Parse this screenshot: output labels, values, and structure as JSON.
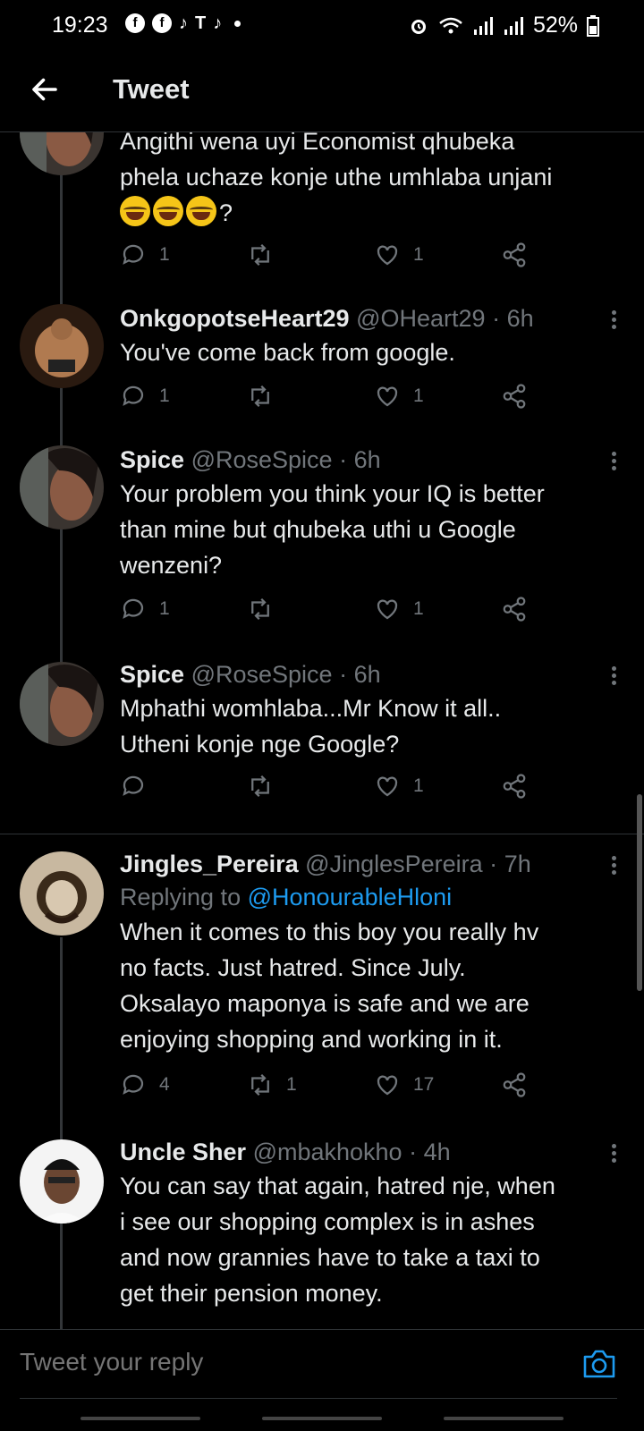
{
  "status_bar": {
    "time": "19:23",
    "battery": "52%",
    "left_icons": [
      "facebook-icon",
      "facebook-icon",
      "tiktok-icon",
      "teams-icon",
      "tiktok-icon"
    ],
    "right_icons": [
      "alarm-icon",
      "wifi-icon",
      "signal-icon",
      "signal-icon",
      "battery-icon"
    ]
  },
  "header": {
    "title": "Tweet"
  },
  "tweets": [
    {
      "text_line1": "Angithi wena uyi Economist qhubeka",
      "text_line2": "phela uchaze konje uthe umhlaba unjani",
      "text_tail": "?",
      "reply_count": "1",
      "retweet_count": "",
      "like_count": "1"
    },
    {
      "name": "OnkgopotseHeart29",
      "handle": "@OHeart29",
      "sep": "·",
      "ago": "6h",
      "text": "You've come back from google.",
      "reply_count": "1",
      "retweet_count": "",
      "like_count": "1"
    },
    {
      "name": "Spice",
      "handle": "@RoseSpice",
      "sep": "·",
      "ago": "6h",
      "text_line1": "Your problem you think your IQ is better",
      "text_line2": "than mine but qhubeka uthi u Google",
      "text_line3": "wenzeni?",
      "reply_count": "1",
      "retweet_count": "",
      "like_count": "1"
    },
    {
      "name": "Spice",
      "handle": "@RoseSpice",
      "sep": "·",
      "ago": "6h",
      "text_line1": "Mphathi womhlaba...Mr Know it all..",
      "text_line2": "Utheni konje nge Google?",
      "reply_count": "",
      "retweet_count": "",
      "like_count": "1"
    },
    {
      "name": "Jingles_Pereira",
      "handle": "@JinglesPereira",
      "sep": "·",
      "ago": "7h",
      "replying_prefix": "Replying to",
      "replying_to": "@HonourableHloni",
      "text_line1": "When it comes to this boy you really hv",
      "text_line2": "no facts. Just hatred. Since July.",
      "text_line3": "Oksalayo maponya is safe and we are",
      "text_line4": "enjoying shopping and working in it.",
      "reply_count": "4",
      "retweet_count": "1",
      "like_count": "17"
    },
    {
      "name": "Uncle Sher",
      "handle": "@mbakhokho",
      "sep": "·",
      "ago": "4h",
      "text_line1": "You can say that again, hatred nje, when",
      "text_line2": "i see our shopping complex is in ashes",
      "text_line3": "and now grannies have to take a taxi to",
      "text_line4": "get their pension money."
    }
  ],
  "reply_bar": {
    "placeholder": "Tweet your reply"
  },
  "colors": {
    "accent": "#1d9bf0",
    "muted": "#71767b",
    "background": "#000000",
    "text": "#e7e9ea"
  }
}
